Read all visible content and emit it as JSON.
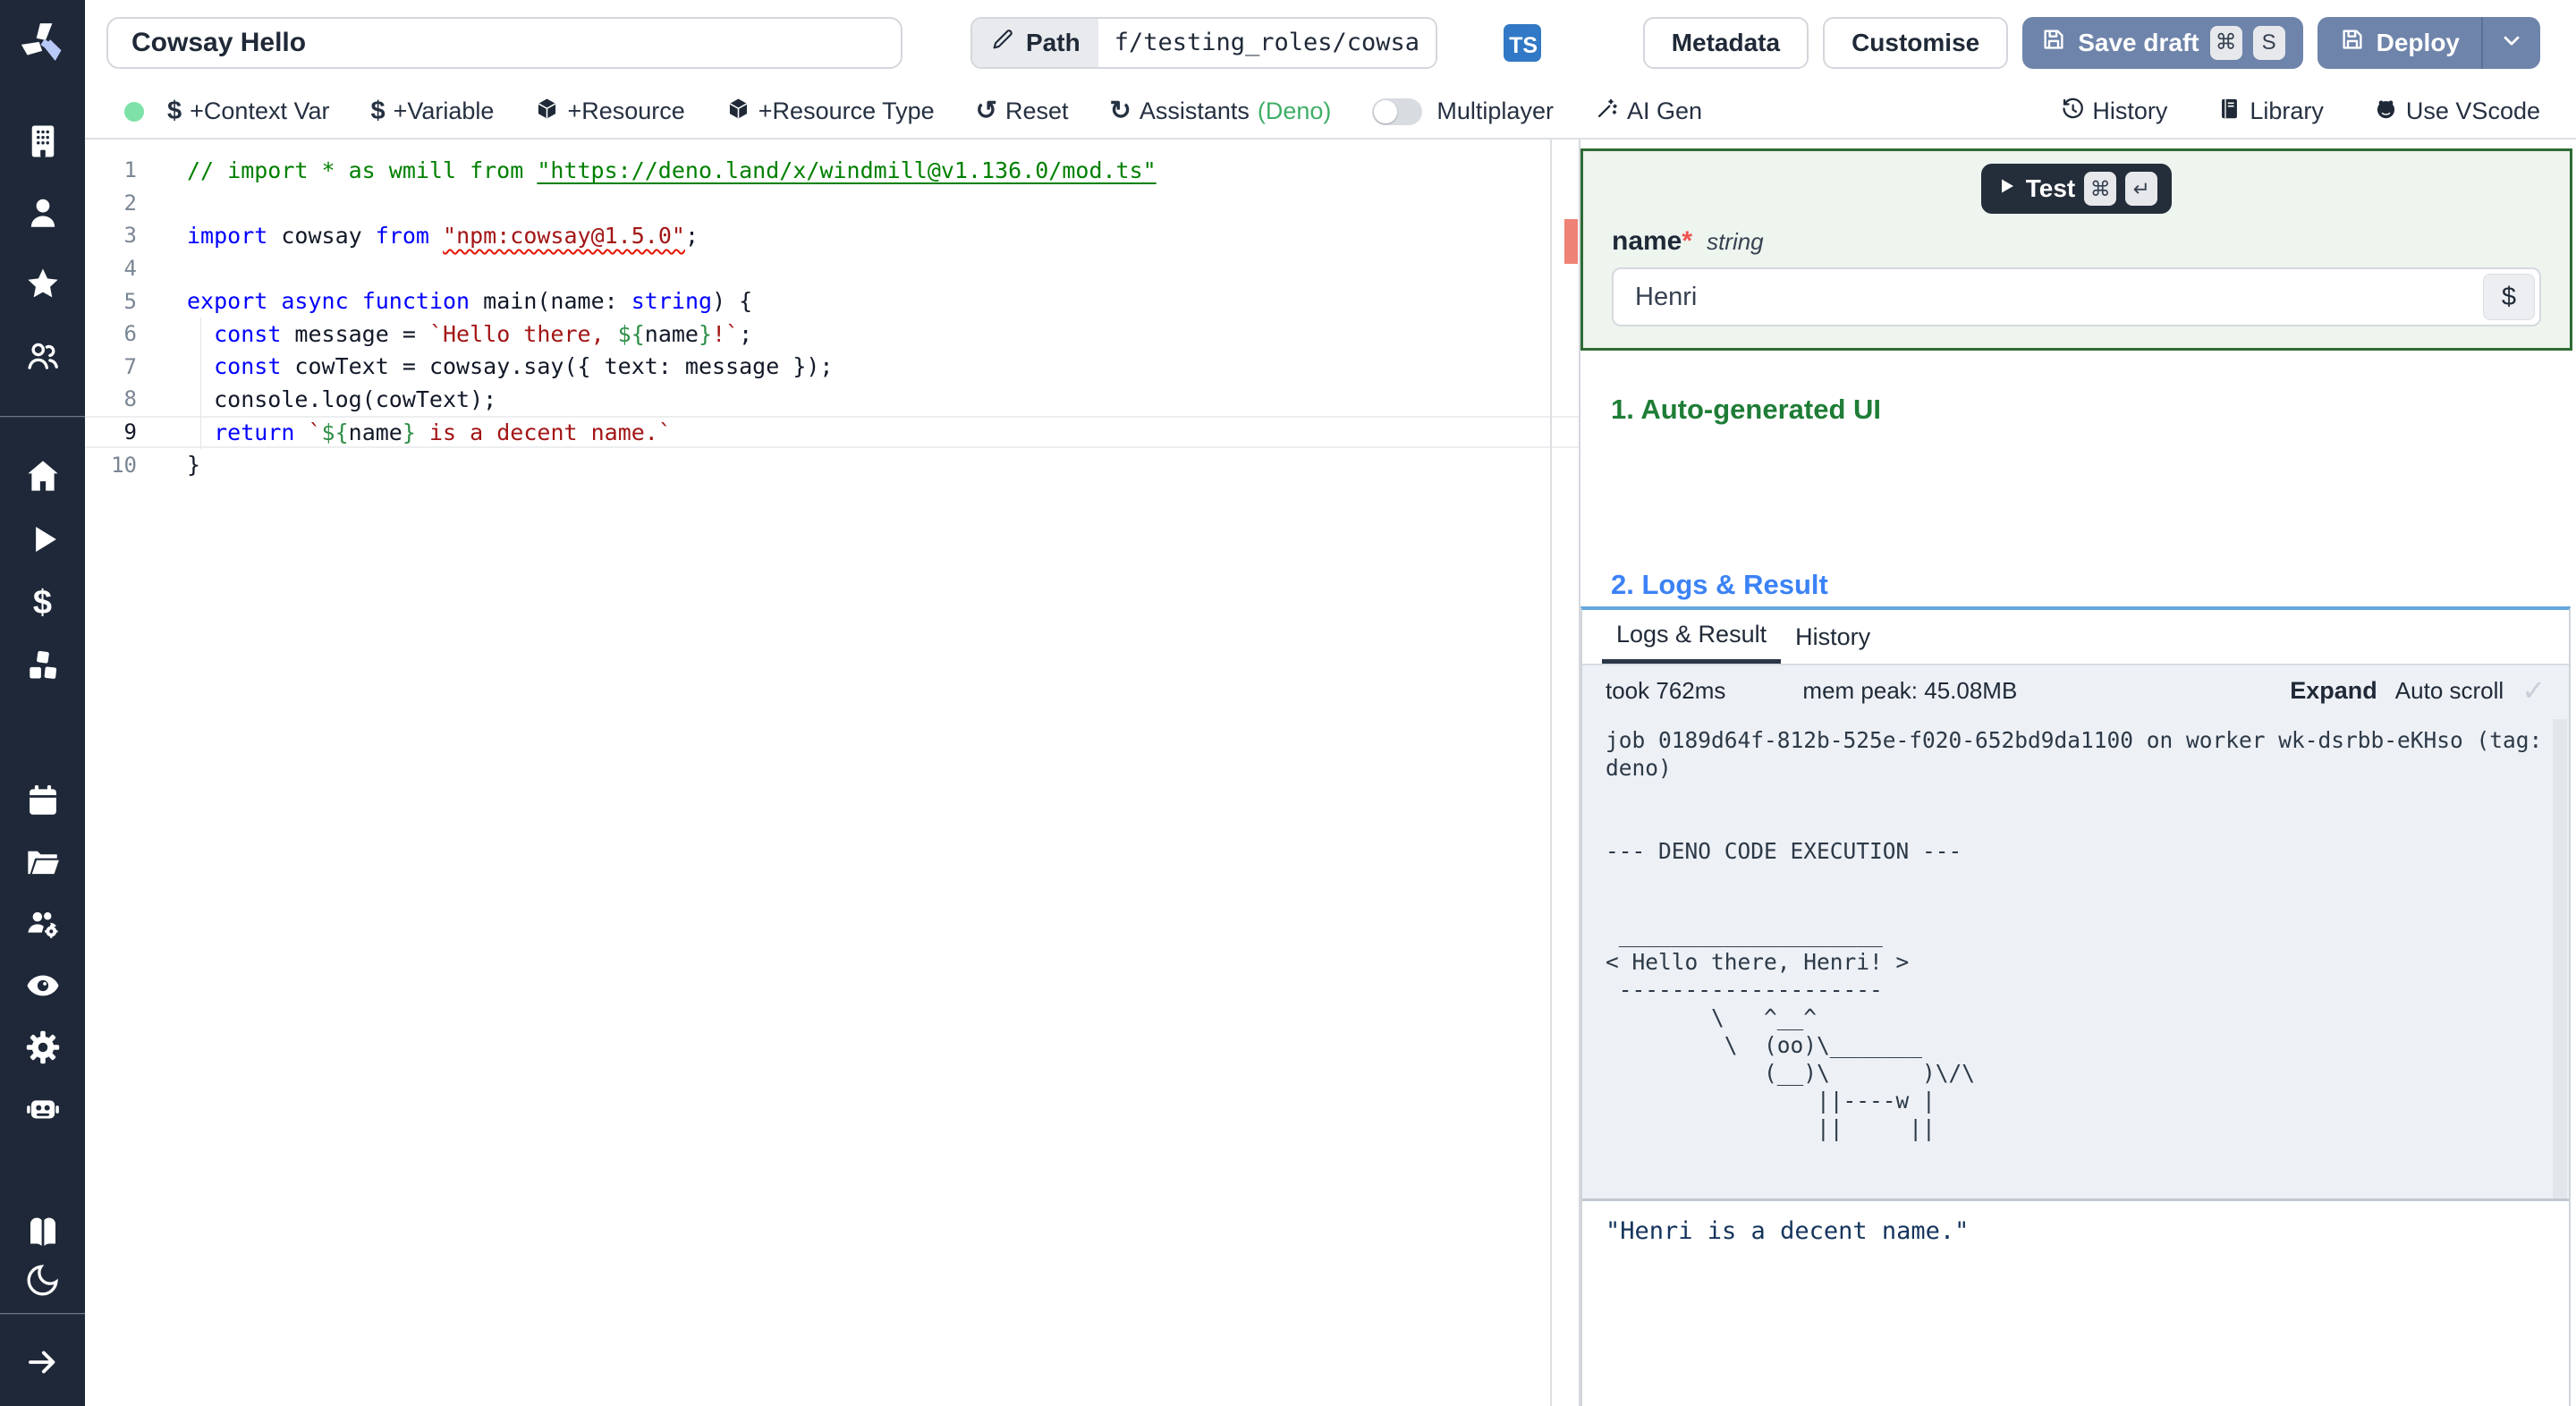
{
  "topbar": {
    "title_value": "Cowsay Hello",
    "path_label": "Path",
    "path_value": "f/testing_roles/cowsa",
    "lang_badge": "TS",
    "metadata_label": "Metadata",
    "customise_label": "Customise",
    "save_draft_label": "Save draft",
    "deploy_label": "Deploy"
  },
  "toolbar": {
    "context_var_label": "+Context Var",
    "variable_label": "+Variable",
    "resource_label": "+Resource",
    "resource_type_label": "+Resource Type",
    "reset_label": "Reset",
    "assistants_label": "Assistants",
    "assistants_lang": "(Deno)",
    "multiplayer_label": "Multiplayer",
    "ai_gen_label": "AI Gen",
    "history_label": "History",
    "library_label": "Library",
    "use_vscode_label": "Use VScode"
  },
  "icons": {
    "dollar": "$",
    "reset": "↺",
    "assistants": "↻",
    "cmd": "⌘",
    "enter": "↵",
    "check": "✓"
  },
  "editor": {
    "active_line": 9,
    "lines": [
      {
        "n": 1,
        "tokens": [
          [
            "c",
            "// import * as wmill from "
          ],
          [
            "cl",
            "\"https://deno.land/x/windmill@v1.136.0/mod.ts\""
          ]
        ]
      },
      {
        "n": 2,
        "tokens": []
      },
      {
        "n": 3,
        "tokens": [
          [
            "k",
            "import"
          ],
          [
            "p",
            " cowsay "
          ],
          [
            "k",
            "from"
          ],
          [
            "p",
            " "
          ],
          [
            "se",
            "\"npm:cowsay@1.5.0\""
          ],
          [
            "p",
            ";"
          ]
        ]
      },
      {
        "n": 4,
        "tokens": []
      },
      {
        "n": 5,
        "tokens": [
          [
            "k",
            "export"
          ],
          [
            "p",
            " "
          ],
          [
            "k",
            "async"
          ],
          [
            "p",
            " "
          ],
          [
            "k",
            "function"
          ],
          [
            "p",
            " main(name: "
          ],
          [
            "k",
            "string"
          ],
          [
            "p",
            ") {"
          ]
        ]
      },
      {
        "n": 6,
        "tokens": [
          [
            "p",
            "  "
          ],
          [
            "k",
            "const"
          ],
          [
            "p",
            " message = "
          ],
          [
            "s",
            "`Hello there, "
          ],
          [
            "g",
            "${"
          ],
          [
            "p",
            "name"
          ],
          [
            "g",
            "}"
          ],
          [
            "s",
            "!`"
          ],
          [
            "p",
            ";"
          ]
        ]
      },
      {
        "n": 7,
        "tokens": [
          [
            "p",
            "  "
          ],
          [
            "k",
            "const"
          ],
          [
            "p",
            " cowText = cowsay.say({ text: message });"
          ]
        ]
      },
      {
        "n": 8,
        "tokens": [
          [
            "p",
            "  console.log(cowText);"
          ]
        ]
      },
      {
        "n": 9,
        "tokens": [
          [
            "p",
            "  "
          ],
          [
            "k",
            "return"
          ],
          [
            "p",
            " "
          ],
          [
            "s",
            "`"
          ],
          [
            "g",
            "${"
          ],
          [
            "p",
            "name"
          ],
          [
            "g",
            "}"
          ],
          [
            "s",
            " is a decent name.`"
          ]
        ]
      },
      {
        "n": 10,
        "tokens": [
          [
            "p",
            "}"
          ]
        ]
      }
    ]
  },
  "panel": {
    "test_label": "Test",
    "field": {
      "name": "name",
      "required_mark": "*",
      "type": "string",
      "value": "Henri",
      "dollar_button": "$"
    },
    "section1_heading": "1. Auto-generated UI",
    "section2_heading": "2. Logs & Result",
    "tabs": {
      "logs_result": "Logs & Result",
      "history": "History"
    },
    "took": "took 762ms",
    "mem_peak": "mem peak: 45.08MB",
    "expand_label": "Expand",
    "autoscroll_label": "Auto scroll",
    "log_text": "job 0189d64f-812b-525e-f020-652bd9da1100 on worker wk-dsrbb-eKHso (tag: deno)\n\n\n--- DENO CODE EXECUTION ---\n\n\n ____________________\n< Hello there, Henri! >\n --------------------\n        \\   ^__^\n         \\  (oo)\\_______\n            (__)\\       )\\/\\\n                ||----w |\n                ||     ||",
    "result_text": "\"Henri is a decent name.\""
  },
  "colors": {
    "sidebar_bg": "#1e2838",
    "ts_badge": "#3178c6",
    "primary_button": "#6e84aa",
    "deno_green": "#3fae68",
    "status_dot_green": "#7ee2a8",
    "form_border_green": "#2e6b33",
    "form_bg": "#eef4ee",
    "heading_green": "#1e7d36",
    "heading_blue": "#3b82f6",
    "logs_bg": "#edf0f5",
    "error_marker": "#ef8276",
    "tab_panel_top_border": "#64a6dd"
  }
}
